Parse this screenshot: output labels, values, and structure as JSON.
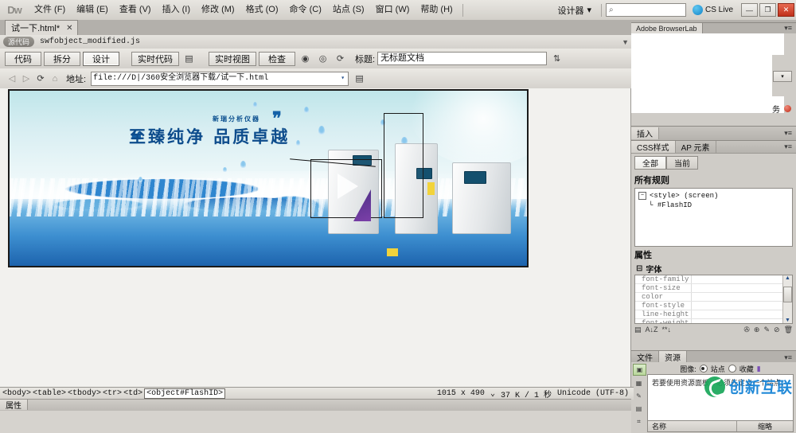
{
  "menu": {
    "logo": "Dw",
    "items": [
      {
        "label": "文件 (F)"
      },
      {
        "label": "编辑 (E)"
      },
      {
        "label": "查看 (V)"
      },
      {
        "label": "插入 (I)"
      },
      {
        "label": "修改 (M)"
      },
      {
        "label": "格式 (O)"
      },
      {
        "label": "命令 (C)"
      },
      {
        "label": "站点 (S)"
      },
      {
        "label": "窗口 (W)"
      },
      {
        "label": "帮助 (H)"
      }
    ],
    "workspace": "设计器",
    "workspace_caret": "▾",
    "search_icon": "⌕",
    "search_value": "",
    "cslive_label": "CS Live",
    "minimize": "—",
    "restore": "❐",
    "close": "✕"
  },
  "tabbar": {
    "tab_label": "试一下.html*",
    "tab_close": "✕",
    "doc_path": "D:\\360安全浏览器下载\\试一下.html"
  },
  "related_files": {
    "source_button": "源代码",
    "file": "swfobject_modified.js",
    "filter_icon": "▼"
  },
  "viewbar": {
    "code": "代码",
    "split": "拆分",
    "design": "设计",
    "live_code": "实时代码",
    "live_code_icon": "▤",
    "live_view": "实时视图",
    "inspect": "检查",
    "globe_icon": "◉",
    "preview_icon": "◎",
    "refresh_icon": "⟳",
    "title_label": "标题:",
    "title_value": "无标题文档",
    "filecheck_icon": "⇅"
  },
  "addressbar": {
    "back_icon": "◁",
    "forward_icon": "▷",
    "refresh_icon": "⟳",
    "home_icon": "⌂",
    "label": "地址:",
    "url": "file:///D|/360安全浏览器下载/试一下.html",
    "dropdown_caret": "▾",
    "list_icon": "▤"
  },
  "banner": {
    "subtitle": "新瑞分析仪器",
    "headline": "至臻纯净  品质卓越",
    "quote_open": "❝",
    "quote_close": "❞"
  },
  "browserlab": {
    "tab_label": "Adobe BrowserLab",
    "menu_icon": "▾≡",
    "dropdown_caret": "▾",
    "service_text": "务",
    "grip": "⠿"
  },
  "insert_panel": {
    "tab_label": "插入",
    "menu_icon": "▾≡"
  },
  "css_panel": {
    "tabs": [
      {
        "label": "CSS样式",
        "active": true
      },
      {
        "label": "AP 元素",
        "active": false
      }
    ],
    "menu_icon": "▾≡",
    "segments": [
      {
        "label": "全部",
        "active": true
      },
      {
        "label": "当前",
        "active": false
      }
    ],
    "rules_title": "所有规则",
    "tree": {
      "toggle": "−",
      "root": "<style> (screen)",
      "child_branch": "└",
      "child": "#FlashID"
    },
    "props_title": "属性",
    "group_toggle": "⊟",
    "group_label": "字体",
    "properties": [
      {
        "key": "font-family",
        "value": ""
      },
      {
        "key": "font-size",
        "value": ""
      },
      {
        "key": "color",
        "value": ""
      },
      {
        "key": "font-style",
        "value": ""
      },
      {
        "key": "line-height",
        "value": ""
      },
      {
        "key": "font-weight",
        "value": ""
      }
    ],
    "scroll_up": "▲",
    "scroll_down": "▼",
    "footer_icons": [
      "▤",
      "A↓Z",
      "**↓",
      "✇",
      "⊕",
      "✎",
      "⊘",
      "🗑"
    ]
  },
  "files_panel": {
    "tabs": [
      {
        "label": "文件",
        "active": false
      },
      {
        "label": "资源",
        "active": true
      }
    ],
    "menu_icon": "▾≡",
    "category_label": "图像:",
    "radios": [
      {
        "label": "站点",
        "checked": true
      },
      {
        "label": "收藏",
        "checked": false
      }
    ],
    "refresh_icon": "▮",
    "empty_message": "若要使用资源面板，必须先定义一个站点。",
    "columns": [
      "名称",
      "缩略"
    ],
    "side_icons": [
      "image-asset-icon",
      "color-asset-icon",
      "link-asset-icon",
      "movie-asset-icon",
      "script-asset-icon"
    ]
  },
  "statusbar": {
    "tags": [
      "<body>",
      "<table>",
      "<tbody>",
      "<tr>",
      "<td>"
    ],
    "selected_tag": "<object#FlashID>",
    "dimensions": "1015 x 490",
    "dim_caret": "⌄",
    "size_time": "37 K / 1 秒",
    "encoding": "Unicode (UTF-8)"
  },
  "propertybar": {
    "tab_label": "属性"
  },
  "watermark": {
    "text": "创新互联"
  },
  "colors": {
    "accent": "#0d4c8c",
    "chrome": "#d6d3ce",
    "close_red": "#c0301a",
    "water_blue": "#2f86cf"
  }
}
